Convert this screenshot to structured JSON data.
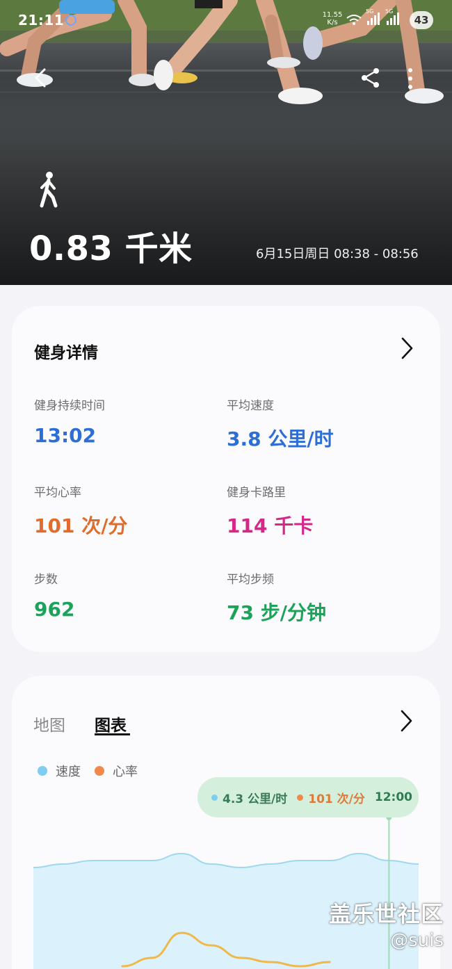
{
  "status_bar": {
    "time": "21:11",
    "net_speed_value": "11.55",
    "net_speed_unit": "K/s",
    "battery": "43",
    "signal_label_1": "5G",
    "signal_label_2": "5G"
  },
  "hero": {
    "distance": "0.83 千米",
    "date_range": "6月15日周日 08:38 - 08:56",
    "activity_icon": "walk-icon"
  },
  "details": {
    "title": "健身详情",
    "metrics": [
      {
        "label": "健身持续时间",
        "value": "13:02",
        "color": "#2d6dd6"
      },
      {
        "label": "平均速度",
        "value": "3.8 公里/时",
        "color": "#2d6dd6"
      },
      {
        "label": "平均心率",
        "value": "101 次/分",
        "color": "#e06c2b"
      },
      {
        "label": "健身卡路里",
        "value": "114 千卡",
        "color": "#d6268a"
      },
      {
        "label": "步数",
        "value": "962",
        "color": "#1ca35a"
      },
      {
        "label": "平均步频",
        "value": "73 步/分钟",
        "color": "#1ca35a"
      }
    ]
  },
  "chart_card": {
    "tabs": [
      {
        "label": "地图",
        "active": false
      },
      {
        "label": "图表",
        "active": true
      }
    ],
    "legend": [
      {
        "label": "速度",
        "color": "#7fcdf0"
      },
      {
        "label": "心率",
        "color": "#f08a4b"
      }
    ],
    "tooltip": {
      "speed": "4.3 公里/时",
      "heart_rate": "101 次/分",
      "time": "12:00"
    }
  },
  "chart_data": {
    "type": "area",
    "series": [
      {
        "name": "速度",
        "color": "#9ed8ef",
        "fill": "#dbf1fb",
        "x": [
          0,
          1,
          2,
          3,
          4,
          5,
          6,
          7,
          8,
          9,
          10,
          11,
          12,
          13
        ],
        "values": [
          4.1,
          4.2,
          4.3,
          4.3,
          4.3,
          4.5,
          4.2,
          4.1,
          4.2,
          4.3,
          4.3,
          4.5,
          4.3,
          4.2
        ]
      },
      {
        "name": "心率",
        "color": "#f0b84a",
        "x": [
          3,
          4,
          5,
          6,
          7,
          8,
          9,
          10
        ],
        "values": [
          96,
          98,
          104,
          101,
          98,
          97,
          96,
          97
        ]
      }
    ],
    "highlight_x": 12,
    "xlim": [
      0,
      13
    ]
  },
  "watermark": {
    "line1": "盖乐世社区",
    "line2": "@suis"
  }
}
